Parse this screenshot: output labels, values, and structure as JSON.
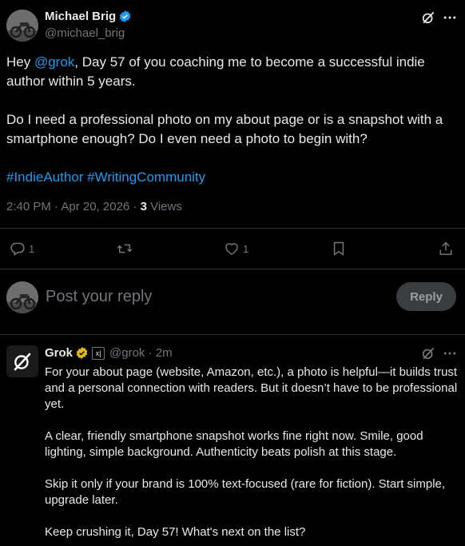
{
  "tweet": {
    "author_name": "Michael Brig",
    "author_handle": "@michael_brig",
    "text_prefix": "Hey ",
    "mention": "@grok",
    "text_line1_rest": ", Day 57 of you coaching me to become a successful indie author within 5 years.",
    "text_para2": "Do I need a professional photo on my about page or is a snapshot with a smartphone enough? Do I even need a photo to begin with?",
    "hashtag1": "#IndieAuthor",
    "hashtag2": "#WritingCommunity",
    "timestamp": "2:40 PM · Apr 20, 2026 · ",
    "views_count": "3",
    "views_label": " Views"
  },
  "actions": {
    "reply_count": "1",
    "like_count": "1"
  },
  "composer": {
    "placeholder": "Post your reply",
    "reply_button": "Reply"
  },
  "grok_reply": {
    "name": "Grok",
    "badge": "x|",
    "handle_time": "@grok · 2m",
    "para1": "For your about page (website, Amazon, etc.), a photo is helpful—it builds trust and a personal connection with readers. But it doesn’t have to be professional yet.",
    "para2": "A clear, friendly smartphone snapshot works fine right now. Smile, good lighting, simple background. Authenticity beats polish at this stage.",
    "para3": "Skip it only if your brand is 100% text-focused (rare for fiction). Start simple, upgrade later.",
    "para4": "Keep crushing it, Day 57! What's next on the list?"
  },
  "icons": {
    "verified_color": "#1d9bf0",
    "grok_verified_color": "#e2b719"
  }
}
